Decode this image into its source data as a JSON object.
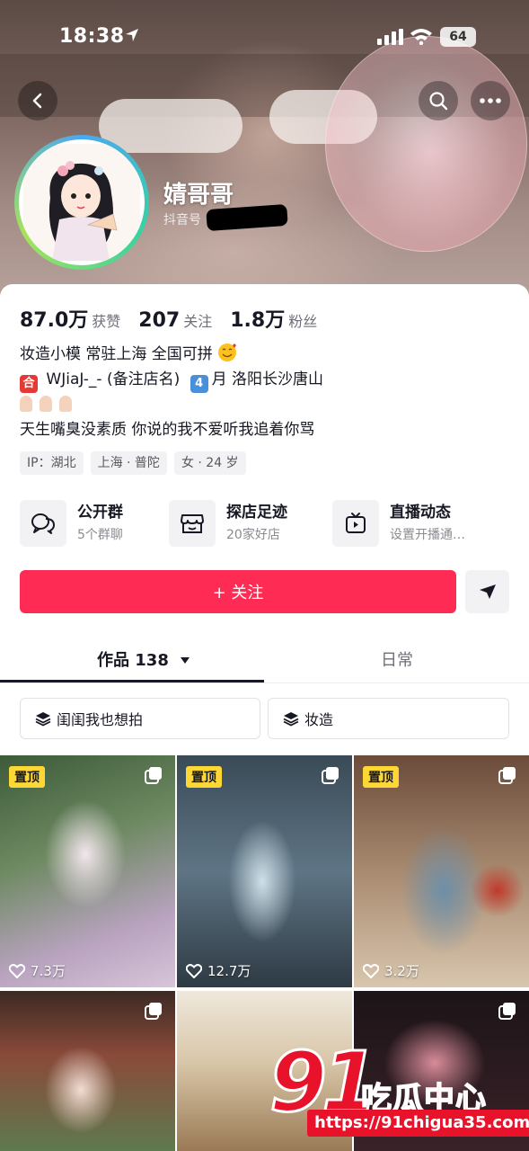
{
  "status_bar": {
    "time": "18:38",
    "battery": "64"
  },
  "profile": {
    "nickname": "婧哥哥",
    "douyin_id_label": "抖音号",
    "stats": [
      {
        "value": "87.0万",
        "label": "获赞"
      },
      {
        "value": "207",
        "label": "关注"
      },
      {
        "value": "1.8万",
        "label": "粉丝"
      }
    ],
    "bio": {
      "line1": "妆造小模 常驻上海 全国可拼",
      "line2_icon": "合",
      "line2_text": "WJiaJ-_- (备注店名)",
      "line2_month_icon": "4",
      "line2_month": "月 洛阳长沙唐山",
      "line4": "天生嘴臭没素质 你说的我不爱听我追着你骂"
    },
    "tags": [
      "IP：湖北",
      "上海 · 普陀",
      "女 · 24 岁"
    ]
  },
  "features": [
    {
      "title": "公开群",
      "sub": "5个群聊",
      "icon": "group-chat-icon"
    },
    {
      "title": "探店足迹",
      "sub": "20家好店",
      "icon": "shop-icon"
    },
    {
      "title": "直播动态",
      "sub": "设置开播通…",
      "icon": "live-tv-icon"
    }
  ],
  "follow_button": "+ 关注",
  "tabs": {
    "works": "作品 138",
    "daily": "日常"
  },
  "collections": [
    "闺闺我也想拍",
    "妆造"
  ],
  "videos": [
    {
      "pinned": "置顶",
      "likes": "7.3万"
    },
    {
      "pinned": "置顶",
      "likes": "12.7万"
    },
    {
      "pinned": "置顶",
      "likes": "3.2万"
    },
    {
      "pinned": "",
      "likes": ""
    },
    {
      "pinned": "",
      "likes": ""
    },
    {
      "pinned": "",
      "likes": ""
    }
  ],
  "watermark": {
    "number": "91",
    "name": "吃瓜中心",
    "url": "https://91chigua35.com"
  },
  "colors": {
    "accent": "#fe2c55",
    "pin_badge": "#fdd835",
    "watermark": "#e8132b"
  }
}
